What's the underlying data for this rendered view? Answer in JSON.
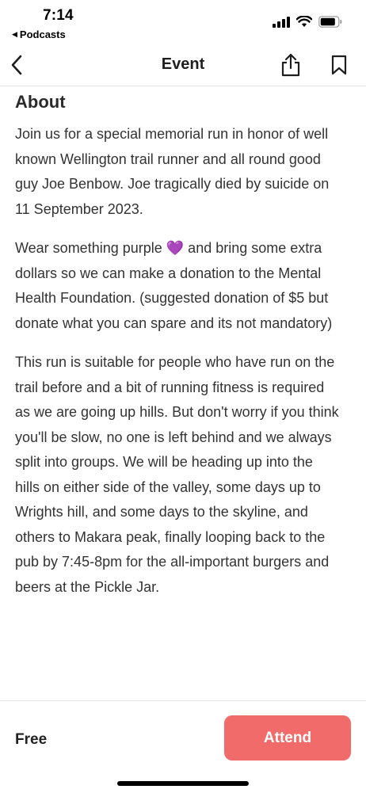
{
  "status_bar": {
    "time": "7:14",
    "back_app": "Podcasts"
  },
  "nav": {
    "title": "Event",
    "back_icon": "chevron-left-icon",
    "share_icon": "share-icon",
    "bookmark_icon": "bookmark-icon"
  },
  "about": {
    "heading": "About",
    "paragraphs": [
      "Join us for a special memorial run in honor of well known Wellington trail runner and all round good guy Joe Benbow. Joe tragically died by suicide on 11 September 2023.",
      "Wear something purple 💜 and bring some extra dollars so we can make a donation to the Mental Health Foundation. (suggested donation of $5 but donate what you can spare and its not mandatory)",
      "This run is suitable for people who have run on the trail before and a bit of running fitness is required as we are going up hills. But don't worry if you think you'll be slow, no one is left behind and we always split into groups. We will be heading up into the hills on either side of the valley, some days up to Wrights hill, and some days to the skyline, and others to Makara peak, finally looping back to the pub by 7:45-8pm for the all-important burgers and beers at the Pickle Jar."
    ]
  },
  "bottom": {
    "price": "Free",
    "attend_label": "Attend",
    "accent_color": "#f26b6b"
  }
}
